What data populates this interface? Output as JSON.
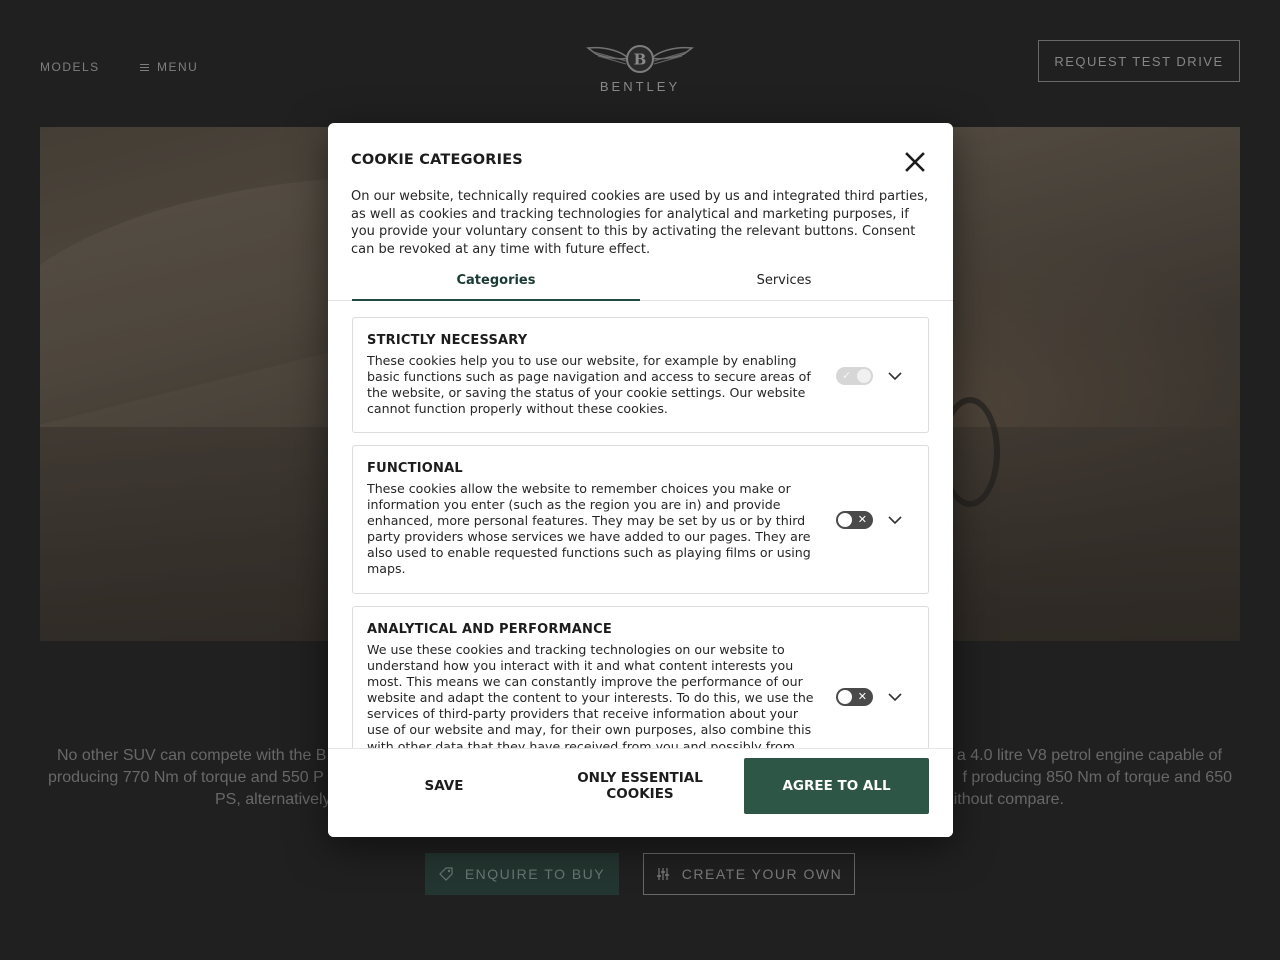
{
  "header": {
    "models_label": "MODELS",
    "menu_label": "MENU",
    "logo_text": "BENTLEY",
    "test_drive_label": "REQUEST TEST DRIVE"
  },
  "intro": {
    "left_fragment_line1": "No other SUV can compete with the B",
    "left_fragment_line2": "producing 770 Nm of torque and 550 P",
    "left_fragment_line3": "PS, alternatively",
    "right_fragment_line1": "a 4.0 litre V8 petrol engine capable of",
    "right_fragment_line2": "f producing 850 Nm of torque and 650",
    "right_fragment_line3": "ithout compare."
  },
  "actions": {
    "enquire_label": "ENQUIRE TO BUY",
    "create_label": "CREATE YOUR OWN"
  },
  "cookie_modal": {
    "title": "COOKIE CATEGORIES",
    "description": "On our website, technically required cookies are used by us and integrated third parties, as well as cookies and tracking technologies for analytical and marketing purposes, if you provide your voluntary consent to this by activating the relevant buttons. Consent can be revoked at any time with future effect.",
    "tabs": [
      {
        "label": "Categories",
        "active": true
      },
      {
        "label": "Services",
        "active": false
      }
    ],
    "categories": [
      {
        "title": "STRICTLY NECESSARY",
        "description": "These cookies help you to use our website, for example by enabling basic functions such as page navigation and access to secure areas of the website, or saving the status of your cookie settings. Our website cannot function properly without these cookies.",
        "enabled": true,
        "locked": true
      },
      {
        "title": "FUNCTIONAL",
        "description": "These cookies allow the website to remember choices you make or information you enter (such as the region you are in) and provide enhanced, more personal features. They may be set by us or by third party providers whose services we have added to our pages. They are also used to enable requested functions such as playing films or using maps.",
        "enabled": false,
        "locked": false
      },
      {
        "title": "ANALYTICAL AND PERFORMANCE",
        "description": "We use these cookies and tracking technologies on our website to understand how you interact with it and what content interests you most. This means we can constantly improve the performance of our website and adapt the content to your interests. To do this, we use the services of third-party providers that receive information about your use of our website and may, for their own purposes, also combine this with other data that they have received from you and possibly from",
        "enabled": false,
        "locked": false
      }
    ],
    "save_label": "SAVE",
    "essential_label": "ONLY ESSENTIAL COOKIES",
    "agree_label": "AGREE TO ALL",
    "accent_color": "#2e5647"
  }
}
